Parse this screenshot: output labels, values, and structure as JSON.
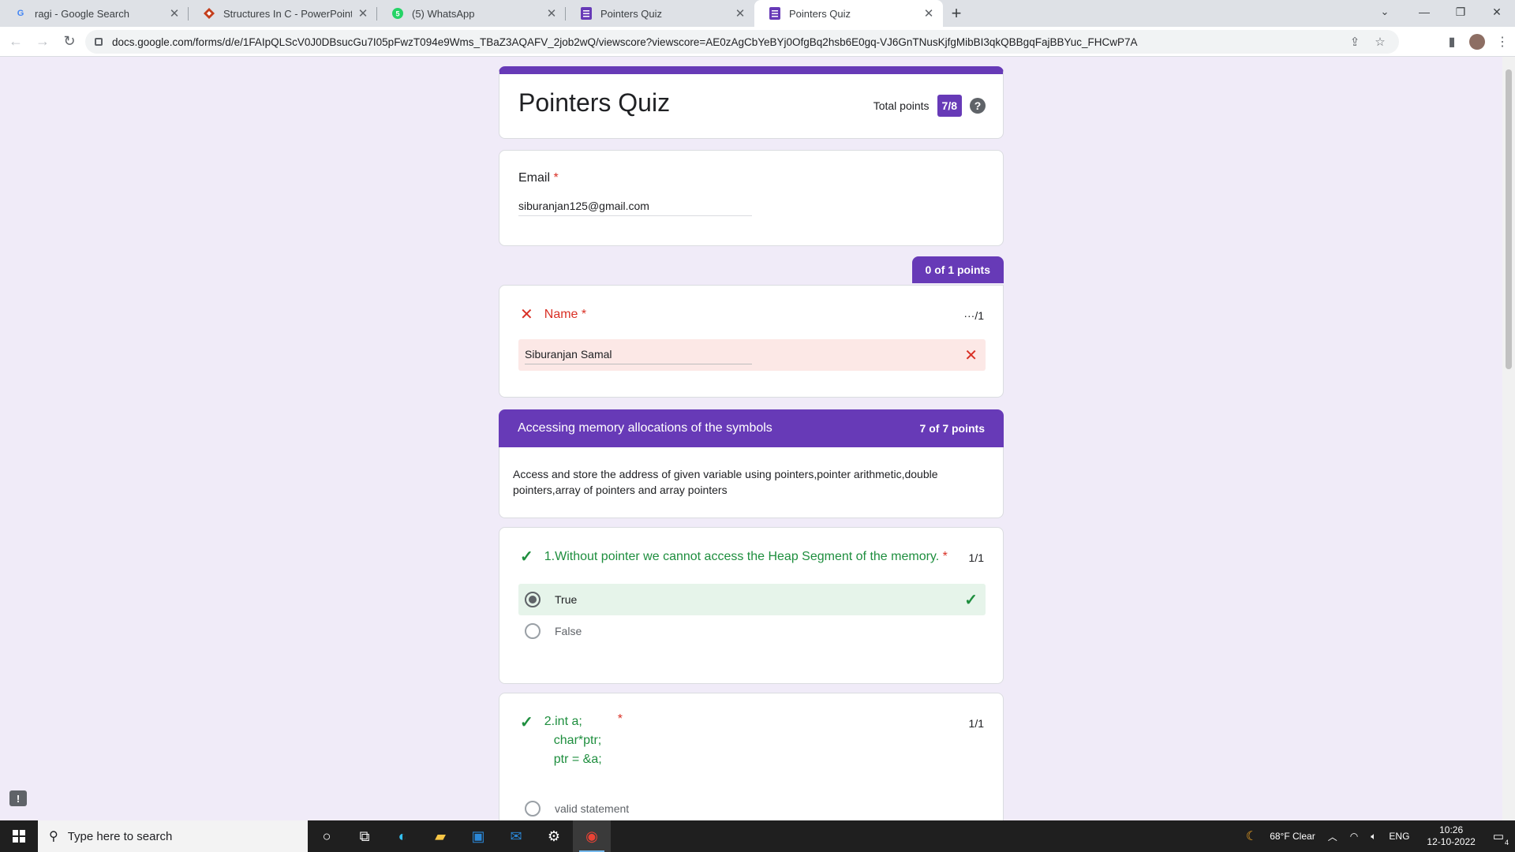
{
  "browser": {
    "tabs": [
      {
        "title": "ragi - Google Search",
        "icon": "google-icon",
        "active": false
      },
      {
        "title": "Structures In C - PowerPoint Slide",
        "icon": "powerpoint-icon",
        "active": false
      },
      {
        "title": "(5) WhatsApp",
        "icon": "whatsapp-icon",
        "active": false
      },
      {
        "title": "Pointers Quiz",
        "icon": "forms-icon",
        "active": false
      },
      {
        "title": "Pointers Quiz",
        "icon": "forms-icon",
        "active": true
      }
    ],
    "url": "docs.google.com/forms/d/e/1FAIpQLScV0J0DBsucGu7I05pFwzT094e9Wms_TBaZ3AQAFV_2job2wQ/viewscore?viewscore=AE0zAgCbYeBYj0OfgBq2hsb6E0gq-VJ6GnTNusKjfgMibBI3qkQBBgqFajBBYuc_FHCwP7A"
  },
  "form": {
    "title": "Pointers Quiz",
    "total_points_label": "Total points",
    "total_score": "7/8",
    "accent_color": "#673ab7",
    "email": {
      "label": "Email",
      "required_mark": "*",
      "value": "siburanjan125@gmail.com"
    },
    "name_block": {
      "points_tab": "0 of 1 points",
      "label": "Name",
      "required_mark": "*",
      "score": "···/1",
      "value": "Siburanjan Samal"
    },
    "section": {
      "title": "Accessing memory allocations of the symbols",
      "points": "7 of 7 points",
      "description": "Access and store the address of given variable using pointers,pointer arithmetic,double pointers,array of pointers and array pointers"
    },
    "q1": {
      "text": "1.Without pointer we cannot access the Heap Segment of the memory.",
      "required_mark": "*",
      "score": "1/1",
      "options": [
        "True",
        "False"
      ],
      "selected": "True"
    },
    "q2": {
      "line1": "2.int a;",
      "line2": "char*ptr;",
      "line3": "ptr = &a;",
      "required_mark": "*",
      "score": "1/1",
      "first_option": "valid statement"
    }
  },
  "taskbar": {
    "search_placeholder": "Type here to search",
    "weather": "68°F  Clear",
    "language": "ENG",
    "time": "10:26",
    "date": "12-10-2022",
    "notifications": "4"
  }
}
